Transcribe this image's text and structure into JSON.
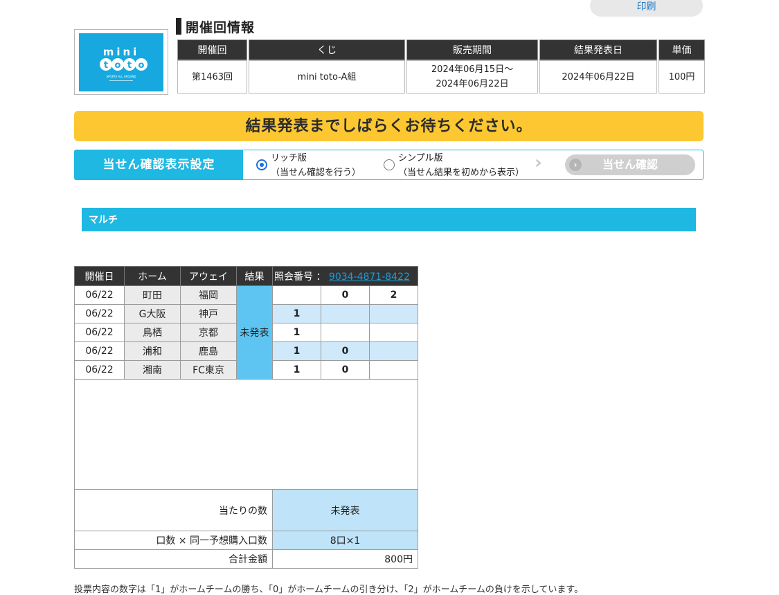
{
  "header": {
    "print_label": "印刷",
    "section_title": "開催回情報"
  },
  "logo": {
    "brand_top": "mini",
    "brand_bottom": "toto",
    "tagline": "SPORTS ALL AROUND",
    "accent": "#16a8de"
  },
  "info_table": {
    "headers": [
      "開催回",
      "くじ",
      "販売期間",
      "結果発表日",
      "単価"
    ],
    "round": "第1463回",
    "lottery": "mini toto-A組",
    "sales_start": "2024年06月15日〜",
    "sales_end": "2024年06月22日",
    "result_date": "2024年06月22日",
    "price": "100円"
  },
  "waiting_banner": "結果発表までしばらくお待ちください。",
  "display_settings": {
    "label": "当せん確認表示設定",
    "rich_title": "リッチ版",
    "rich_sub": "（当せん確認を行う）",
    "simple_title": "シンプル版",
    "simple_sub": "（当せん結果を初めから表示）",
    "selected": "rich",
    "confirm_button": "当せん確認"
  },
  "multi_section": {
    "title": "マルチ"
  },
  "match_table": {
    "headers": {
      "date": "開催日",
      "home": "ホーム",
      "away": "アウェイ",
      "result": "結果",
      "ref_label": "照会番号 ：",
      "ref_number": "9034-4871-8422"
    },
    "result_status": "未発表",
    "rows": [
      {
        "date": "06/22",
        "home": "町田",
        "away": "福岡",
        "p1": "",
        "p2": "0",
        "p3": "2"
      },
      {
        "date": "06/22",
        "home": "G大阪",
        "away": "神戸",
        "p1": "1",
        "p2": "",
        "p3": ""
      },
      {
        "date": "06/22",
        "home": "鳥栖",
        "away": "京都",
        "p1": "1",
        "p2": "",
        "p3": ""
      },
      {
        "date": "06/22",
        "home": "浦和",
        "away": "鹿島",
        "p1": "1",
        "p2": "0",
        "p3": ""
      },
      {
        "date": "06/22",
        "home": "湘南",
        "away": "FC東京",
        "p1": "1",
        "p2": "0",
        "p3": ""
      }
    ],
    "summary": {
      "wins_label": "当たりの数",
      "wins_value": "未発表",
      "units_label": "口数 × 同一予想購入口数",
      "units_value": "8口×1",
      "total_label": "合計金額",
      "total_value": "800円"
    }
  },
  "footer_note": "投票内容の数字は「1」がホームチームの勝ち、「0」がホームチームの引き分け、「2」がホームチームの負けを示しています。"
}
